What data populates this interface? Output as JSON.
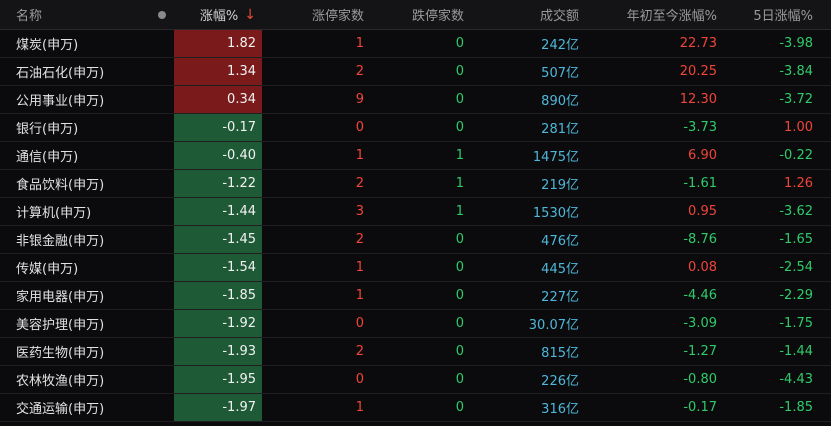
{
  "header": {
    "name": "名称",
    "pct": "涨幅%",
    "sort_arrow": "↓",
    "limit_up": "涨停家数",
    "limit_down": "跌停家数",
    "volume": "成交额",
    "ytd": "年初至今涨幅%",
    "five_day": "5日涨幅%"
  },
  "colors": {
    "up_bg": "#7a1a1a",
    "down_bg": "#1e5a36",
    "up_text": "#f0453a",
    "down_text": "#2fcb6a",
    "volume_text": "#4fb7d9"
  },
  "rows": [
    {
      "name": "煤炭(申万)",
      "pct": "1.82",
      "dir": "up",
      "limit_up": "1",
      "limit_down": "0",
      "volume": "242亿",
      "ytd": "22.73",
      "ytd_dir": "up",
      "five_day": "-3.98",
      "five_dir": "down"
    },
    {
      "name": "石油石化(申万)",
      "pct": "1.34",
      "dir": "up",
      "limit_up": "2",
      "limit_down": "0",
      "volume": "507亿",
      "ytd": "20.25",
      "ytd_dir": "up",
      "five_day": "-3.84",
      "five_dir": "down"
    },
    {
      "name": "公用事业(申万)",
      "pct": "0.34",
      "dir": "up",
      "limit_up": "9",
      "limit_down": "0",
      "volume": "890亿",
      "ytd": "12.30",
      "ytd_dir": "up",
      "five_day": "-3.72",
      "five_dir": "down"
    },
    {
      "name": "银行(申万)",
      "pct": "-0.17",
      "dir": "down",
      "limit_up": "0",
      "limit_down": "0",
      "volume": "281亿",
      "ytd": "-3.73",
      "ytd_dir": "down",
      "five_day": "1.00",
      "five_dir": "up"
    },
    {
      "name": "通信(申万)",
      "pct": "-0.40",
      "dir": "down",
      "limit_up": "1",
      "limit_down": "1",
      "volume": "1475亿",
      "ytd": "6.90",
      "ytd_dir": "up",
      "five_day": "-0.22",
      "five_dir": "down"
    },
    {
      "name": "食品饮料(申万)",
      "pct": "-1.22",
      "dir": "down",
      "limit_up": "2",
      "limit_down": "1",
      "volume": "219亿",
      "ytd": "-1.61",
      "ytd_dir": "down",
      "five_day": "1.26",
      "five_dir": "up"
    },
    {
      "name": "计算机(申万)",
      "pct": "-1.44",
      "dir": "down",
      "limit_up": "3",
      "limit_down": "1",
      "volume": "1530亿",
      "ytd": "0.95",
      "ytd_dir": "up",
      "five_day": "-3.62",
      "five_dir": "down"
    },
    {
      "name": "非银金融(申万)",
      "pct": "-1.45",
      "dir": "down",
      "limit_up": "2",
      "limit_down": "0",
      "volume": "476亿",
      "ytd": "-8.76",
      "ytd_dir": "down",
      "five_day": "-1.65",
      "five_dir": "down"
    },
    {
      "name": "传媒(申万)",
      "pct": "-1.54",
      "dir": "down",
      "limit_up": "1",
      "limit_down": "0",
      "volume": "445亿",
      "ytd": "0.08",
      "ytd_dir": "up",
      "five_day": "-2.54",
      "five_dir": "down"
    },
    {
      "name": "家用电器(申万)",
      "pct": "-1.85",
      "dir": "down",
      "limit_up": "1",
      "limit_down": "0",
      "volume": "227亿",
      "ytd": "-4.46",
      "ytd_dir": "down",
      "five_day": "-2.29",
      "five_dir": "down"
    },
    {
      "name": "美容护理(申万)",
      "pct": "-1.92",
      "dir": "down",
      "limit_up": "0",
      "limit_down": "0",
      "volume": "30.07亿",
      "ytd": "-3.09",
      "ytd_dir": "down",
      "five_day": "-1.75",
      "five_dir": "down"
    },
    {
      "name": "医药生物(申万)",
      "pct": "-1.93",
      "dir": "down",
      "limit_up": "2",
      "limit_down": "0",
      "volume": "815亿",
      "ytd": "-1.27",
      "ytd_dir": "down",
      "five_day": "-1.44",
      "five_dir": "down"
    },
    {
      "name": "农林牧渔(申万)",
      "pct": "-1.95",
      "dir": "down",
      "limit_up": "0",
      "limit_down": "0",
      "volume": "226亿",
      "ytd": "-0.80",
      "ytd_dir": "down",
      "five_day": "-4.43",
      "five_dir": "down"
    },
    {
      "name": "交通运输(申万)",
      "pct": "-1.97",
      "dir": "down",
      "limit_up": "1",
      "limit_down": "0",
      "volume": "316亿",
      "ytd": "-0.17",
      "ytd_dir": "down",
      "five_day": "-1.85",
      "five_dir": "down"
    }
  ]
}
